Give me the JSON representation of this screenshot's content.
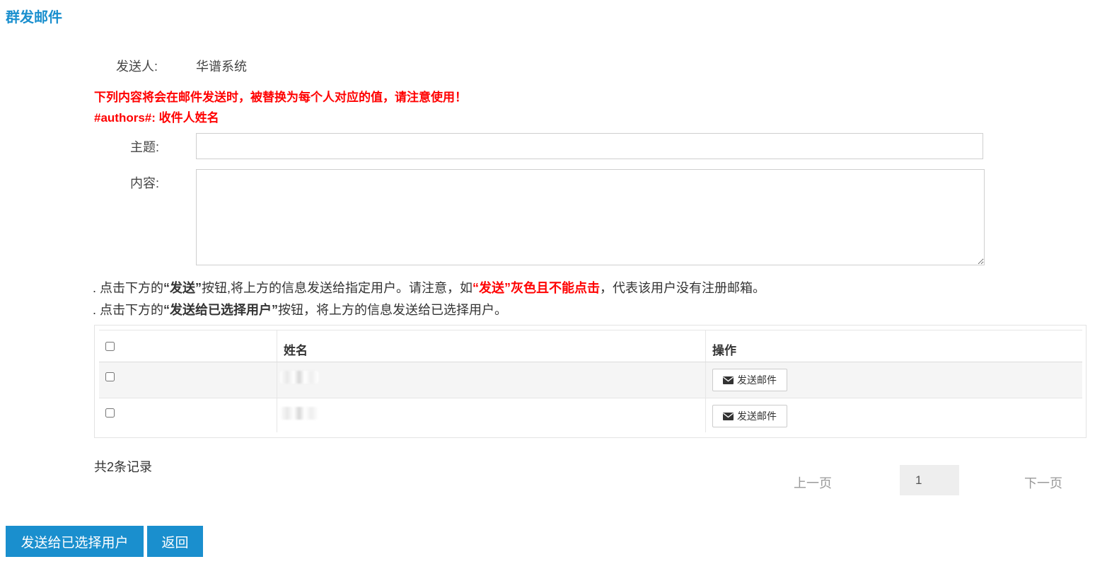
{
  "page": {
    "title": "群发邮件"
  },
  "sender": {
    "label": "发送人:",
    "value": "华谱系统"
  },
  "warning": {
    "line1": "下列内容将会在邮件发送时，被替换为每个人对应的值，请注意使用！",
    "line2": "#authors#: 收件人姓名"
  },
  "form": {
    "subject_label": "主题:",
    "subject_value": "",
    "content_label": "内容:",
    "content_value": ""
  },
  "notes": {
    "line1": {
      "prefix": ". 点击下方的",
      "quote_send": "“发送”",
      "middle": "按钮,将上方的信息发送给指定用户。请注意，如",
      "red": "“发送”灰色且不能点击",
      "suffix": "，代表该用户没有注册邮箱。"
    },
    "line2": {
      "prefix": ". 点击下方的",
      "quote_bold": "“发送给已选择用户”",
      "suffix": "按钮，将上方的信息发送给已选择用户。"
    }
  },
  "table": {
    "columns": [
      "",
      "姓名",
      "操作"
    ],
    "rows": [
      {
        "checked": false,
        "name": "",
        "action_label": "发送邮件"
      },
      {
        "checked": false,
        "name": "",
        "action_label": "发送邮件"
      }
    ]
  },
  "pagination": {
    "total_text": "共2条记录",
    "prev_label": "上一页",
    "current_page": "1",
    "next_label": "下一页"
  },
  "actions": {
    "send_selected_label": "发送给已选择用户",
    "back_label": "返回"
  },
  "colors": {
    "accent": "#1a8fce",
    "warning": "#ff0000"
  },
  "icons": {
    "send_button_icon": "envelope-icon"
  }
}
